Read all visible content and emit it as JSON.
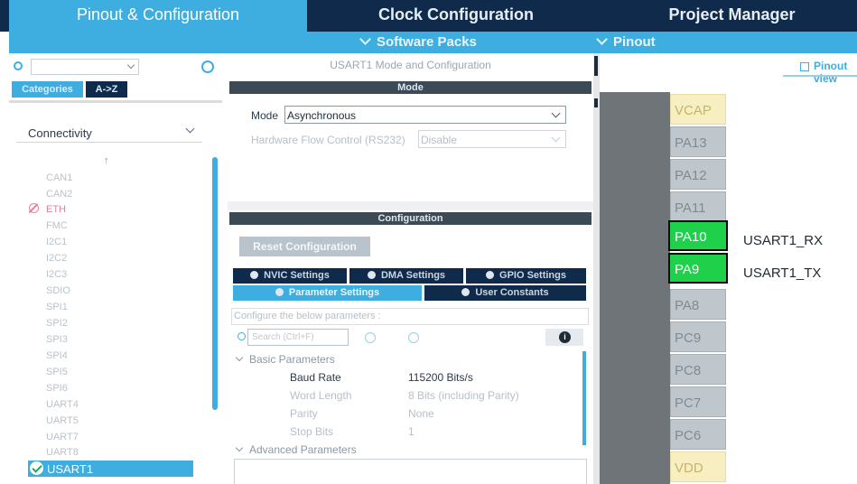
{
  "top_tabs": {
    "pinout_config": "Pinout & Configuration",
    "clock_config": "Clock Configuration",
    "project_manager": "Project Manager"
  },
  "sub_bar": {
    "software_packs": "Software Packs",
    "pinout": "Pinout"
  },
  "left": {
    "tabs": [
      "Categories",
      "A->Z"
    ],
    "category": "Connectivity",
    "items": [
      "CAN1",
      "CAN2",
      "ETH",
      "FMC",
      "I2C1",
      "I2C2",
      "I2C3",
      "SDIO",
      "SPI1",
      "SPI2",
      "SPI3",
      "SPI4",
      "SPI5",
      "SPI6",
      "UART4",
      "UART5",
      "UART7",
      "UART8"
    ],
    "selected": "USART1"
  },
  "mode_panel": {
    "title": "USART1 Mode and Configuration",
    "mode_header": "Mode",
    "mode_label": "Mode",
    "mode_value": "Asynchronous",
    "flow_label": "Hardware Flow Control (RS232)",
    "flow_value": "Disable",
    "config_header": "Configuration",
    "reset_button": "Reset Configuration",
    "tabs_row1": [
      "NVIC Settings",
      "DMA Settings",
      "GPIO Settings"
    ],
    "tabs_row2": [
      "Parameter Settings",
      "User Constants"
    ],
    "hint": "Configure the below parameters :",
    "search_placeholder": "Search (Ctrl+F)",
    "group_basic": "Basic Parameters",
    "params": [
      {
        "name": "Baud Rate",
        "value": "115200 Bits/s"
      },
      {
        "name": "Word Length",
        "value": "8 Bits (including Parity)"
      },
      {
        "name": "Parity",
        "value": "None"
      },
      {
        "name": "Stop Bits",
        "value": "1"
      }
    ],
    "group_advanced": "Advanced Parameters"
  },
  "pinout": {
    "view_label": "Pinout view",
    "pins": [
      "VCAP",
      "PA13",
      "PA12",
      "PA11",
      "PA10",
      "PA9",
      "PA8",
      "PC9",
      "PC8",
      "PC7",
      "PC6",
      "VDD"
    ],
    "signals": {
      "PA10": "USART1_RX",
      "PA9": "USART1_TX"
    }
  },
  "colors": {
    "accent": "#3eaee0",
    "dark_navy": "#0f2a4a",
    "pin_green": "#1fd04a",
    "pin_gray": "#bfc7cd",
    "pin_power": "#f7efc2"
  }
}
